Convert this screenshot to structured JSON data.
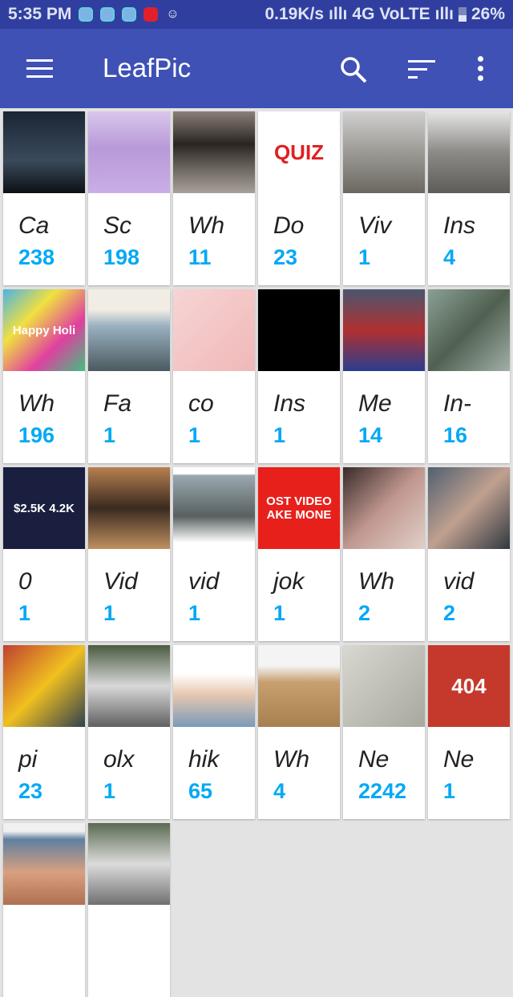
{
  "status_bar": {
    "time": "5:35 PM",
    "speed": "0.19K/s",
    "network": "4G VoLTE",
    "battery": "26%"
  },
  "app_bar": {
    "title": "LeafPic"
  },
  "albums": [
    {
      "name": "Ca",
      "count": "238",
      "bg": "linear-gradient(#1b2536,#3a4a5a 60%,#0d1016)"
    },
    {
      "name": "Sc",
      "count": "198",
      "bg": "linear-gradient(#d8c6ec,#b999d8 45%,#c9aee6)"
    },
    {
      "name": "Wh",
      "count": "11",
      "bg": "linear-gradient(#8a7f78,#2a2420 40%,#6d6760 70%,#a9a09a)"
    },
    {
      "name": "Do",
      "count": "23",
      "bg": "#fff",
      "thumb_text": "QUIZ",
      "thumb_color": "#e02020"
    },
    {
      "name": "Viv",
      "count": "1",
      "bg": "linear-gradient(#cfcfcf,#9d9a95 50%,#6a6860)"
    },
    {
      "name": "Ins",
      "count": "4",
      "bg": "linear-gradient(#e5e5e5,#8c8a86 50%,#5e5c58)"
    },
    {
      "name": "Wh",
      "count": "196",
      "bg": "linear-gradient(135deg,#4cb3e6,#f0e040,#e040a0,#40c080)",
      "thumb_text": "Happy Holi",
      "thumb_color": "#fff"
    },
    {
      "name": "Fa",
      "count": "1",
      "bg": "linear-gradient(#f2ede4 25%,#9ab0c0 45%,#4a5a60)"
    },
    {
      "name": "co",
      "count": "1",
      "bg": "linear-gradient(135deg,#f7d4d4,#f0b8b8)"
    },
    {
      "name": "Ins",
      "count": "1",
      "bg": "#000"
    },
    {
      "name": "Me",
      "count": "14",
      "bg": "linear-gradient(#4a5670,#b03030 50%,#2b3d8f)"
    },
    {
      "name": "In-",
      "count": "16",
      "bg": "linear-gradient(135deg,#8aa095,#506050,#a0b0a8)"
    },
    {
      "name": "0",
      "count": "1",
      "bg": "#1a1f40",
      "thumb_text": "$2.5K  4.2K",
      "thumb_color": "#fff"
    },
    {
      "name": "Vid",
      "count": "1",
      "bg": "linear-gradient(#b88050,#3a2a20 50%,#c09060)"
    },
    {
      "name": "vid",
      "count": "1",
      "bg": "linear-gradient(#fff 0,#fff 8%,#9aa8b0 10%,#586060 60%,#fff 92%)"
    },
    {
      "name": "jok",
      "count": "1",
      "bg": "#e8201c",
      "thumb_text": "OST VIDEO AKE MONE",
      "thumb_color": "#fff"
    },
    {
      "name": "Wh",
      "count": "2",
      "bg": "linear-gradient(135deg,#3a2a2a,#c09890,#e0d0c8)"
    },
    {
      "name": "vid",
      "count": "2",
      "bg": "linear-gradient(135deg,#506070,#c0a090,#303840)"
    },
    {
      "name": "pi",
      "count": "23",
      "bg": "linear-gradient(135deg,#c04030,#f0c020,#304050)"
    },
    {
      "name": "olx",
      "count": "1",
      "bg": "linear-gradient(#4a5a40,#d8d8d8 50%,#606060)"
    },
    {
      "name": "hik",
      "count": "65",
      "bg": "linear-gradient(#fff 35%,#e8c8b0 60%,#7a9ab8)"
    },
    {
      "name": "Wh",
      "count": "4",
      "bg": "linear-gradient(#f4f4f4 25%,#c8a070 45%,#a88050)"
    },
    {
      "name": "Ne",
      "count": "2242",
      "bg": "linear-gradient(135deg,#d8d8d0,#a8a8a0)"
    },
    {
      "name": "Ne",
      "count": "1",
      "bg": "#c4392c",
      "thumb_text": "404",
      "thumb_color": "#fff"
    },
    {
      "name": "",
      "count": "",
      "bg": "linear-gradient(#f0f0f0 10%,#6080a0 20%,#d8a080 60%,#b07050)"
    },
    {
      "name": "",
      "count": "",
      "bg": "linear-gradient(#5a6a50,#dcdcdc 50%,#707070)"
    }
  ],
  "colors": {
    "app_bar": "#3f51b5",
    "status_bar": "#303f9f",
    "count": "#03a9f4"
  }
}
